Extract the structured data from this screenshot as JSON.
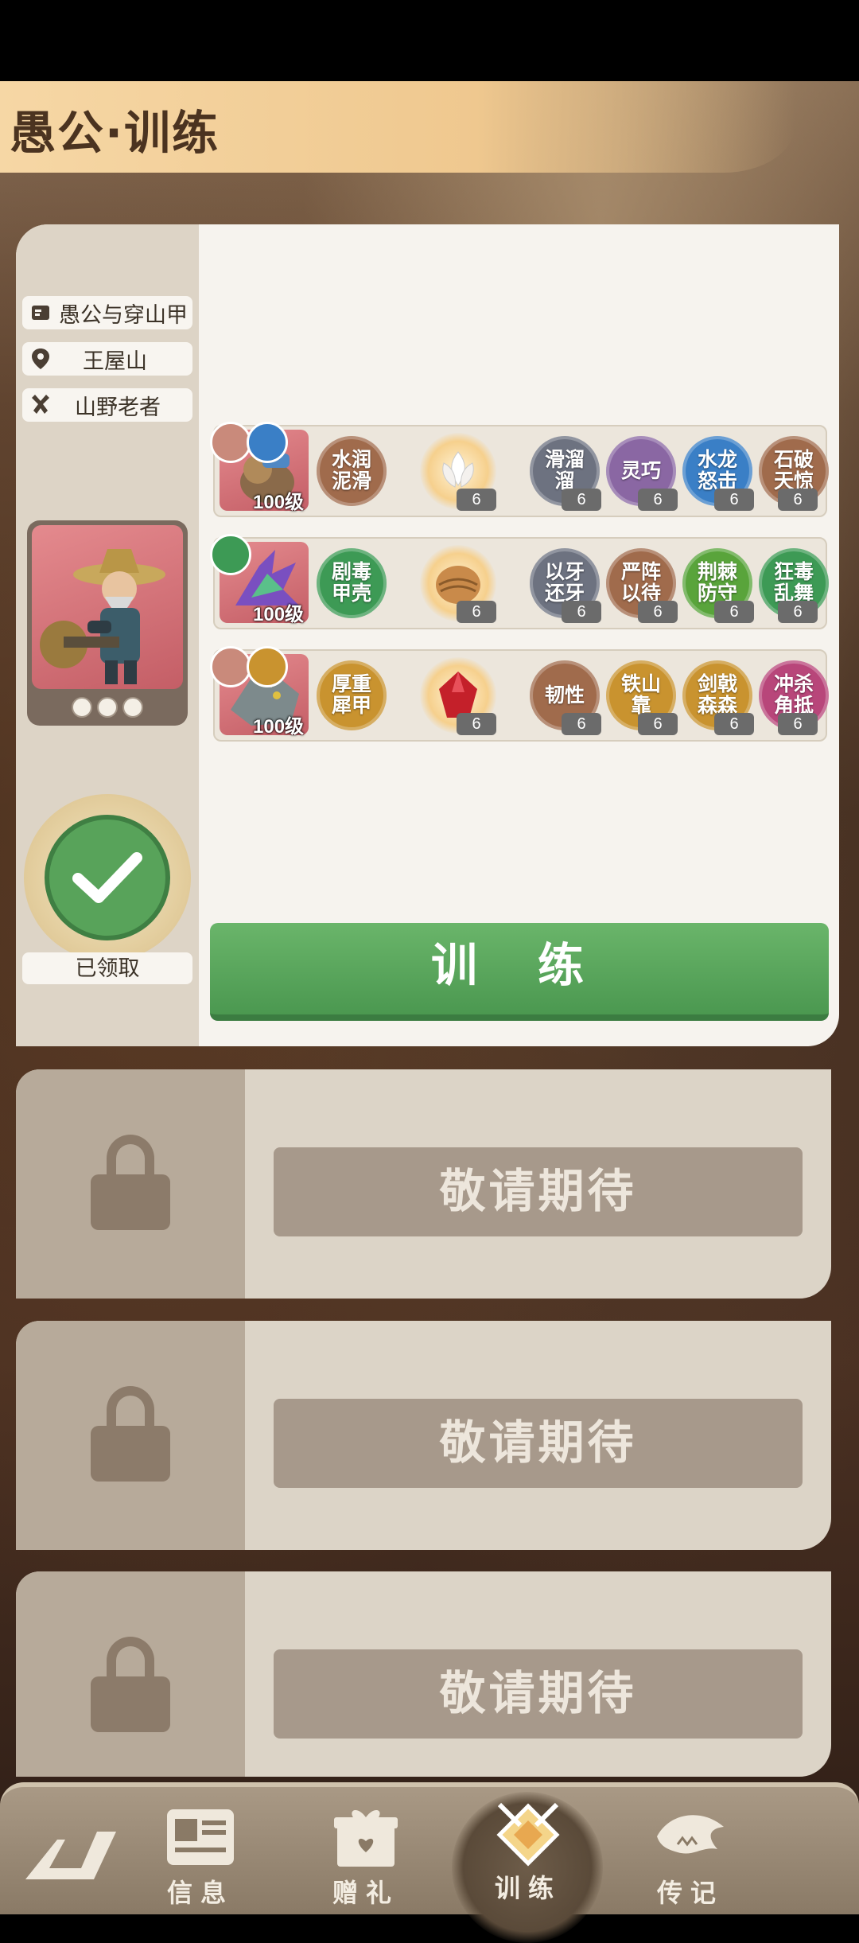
{
  "title": "愚公·训练",
  "info": {
    "story": "愚公与穿山甲",
    "location": "王屋山",
    "role": "山野老者"
  },
  "claim_status": "已领取",
  "pets": [
    {
      "level": "100级",
      "skills": [
        {
          "name": "水润泥滑",
          "color": "#a06b4c"
        },
        {
          "name": "滑溜溜",
          "level": "6",
          "color": "#6d7280"
        },
        {
          "name": "灵巧",
          "level": "6",
          "color": "#8a67a3"
        },
        {
          "name": "水龙怒击",
          "level": "6",
          "color": "#3a7fc6"
        },
        {
          "name": "石破天惊",
          "level": "6",
          "color": "#a06b4c"
        }
      ],
      "item_level": "6"
    },
    {
      "level": "100级",
      "skills": [
        {
          "name": "剧毒甲壳",
          "color": "#3d9a55"
        },
        {
          "name": "以牙还牙",
          "level": "6",
          "color": "#6d7280"
        },
        {
          "name": "严阵以待",
          "level": "6",
          "color": "#a06b4c"
        },
        {
          "name": "荆棘防守",
          "level": "6",
          "color": "#59a43b"
        },
        {
          "name": "狂毒乱舞",
          "level": "6",
          "color": "#3d9a55"
        }
      ],
      "item_level": "6"
    },
    {
      "level": "100级",
      "skills": [
        {
          "name": "厚重犀甲",
          "color": "#c9932f"
        },
        {
          "name": "韧性",
          "level": "6",
          "color": "#a06b4c"
        },
        {
          "name": "铁山靠",
          "level": "6",
          "color": "#c9932f"
        },
        {
          "name": "剑戟森森",
          "level": "6",
          "color": "#c9932f"
        },
        {
          "name": "冲杀角抵",
          "level": "6",
          "color": "#b8467a"
        }
      ],
      "item_level": "6"
    }
  ],
  "train_button": "训 练",
  "locked_label": "敬请期待",
  "tabs": [
    {
      "label": "信息"
    },
    {
      "label": "赠礼"
    },
    {
      "label": "训练"
    },
    {
      "label": "传记"
    }
  ]
}
